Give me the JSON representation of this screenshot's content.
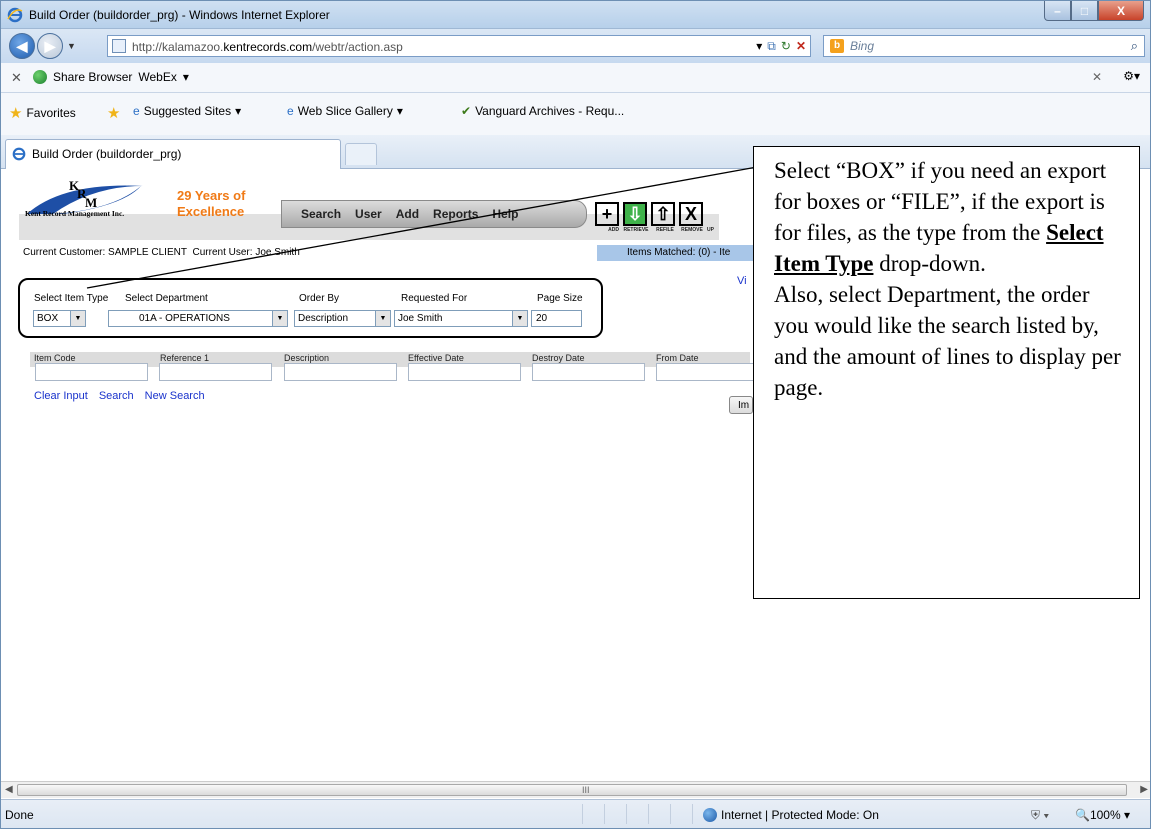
{
  "window": {
    "title": "Build Order (buildorder_prg) - Windows Internet Explorer"
  },
  "address": {
    "url_prefix": "http://kalamazoo.",
    "url_domain": "kentrecords.com",
    "url_suffix": "/webtr/action.asp"
  },
  "search": {
    "placeholder": "Bing"
  },
  "toolbar": {
    "share_browser": "Share Browser",
    "webex": "WebEx"
  },
  "favorites": {
    "label": "Favorites",
    "items": [
      "Suggested Sites",
      "Web Slice Gallery",
      "Vanguard Archives - Requ..."
    ]
  },
  "tab": {
    "title": "Build Order (buildorder_prg)"
  },
  "app": {
    "logo_brand": "Kent Record Management Inc.",
    "logo_letters": "KRM",
    "tagline_1": "29 Years of",
    "tagline_2": "Excellence",
    "menu": [
      "Search",
      "User",
      "Add",
      "Reports",
      "Help"
    ],
    "actions": [
      {
        "symbol": "+",
        "label": "ADD"
      },
      {
        "symbol": "⇩",
        "label": "RETRIEVE"
      },
      {
        "symbol": "⇧",
        "label": "REFILE"
      },
      {
        "symbol": "X",
        "label": "REMOVE"
      }
    ],
    "action_extra_label": "UP",
    "customer_label": "Current Customer:",
    "customer": "SAMPLE CLIENT",
    "user_label": "Current User:",
    "user": "Joe Smith",
    "items_matched": "Items Matched: (0) - Ite",
    "vi_link": "Vi"
  },
  "filters": {
    "item_type_label": "Select Item Type",
    "item_type_value": "BOX",
    "department_label": "Select Department",
    "department_value": "01A - OPERATIONS",
    "order_by_label": "Order By",
    "order_by_value": "Description",
    "requested_for_label": "Requested For",
    "requested_for_value": "Joe Smith",
    "page_size_label": "Page Size",
    "page_size_value": "20"
  },
  "grid": {
    "columns": [
      "Item Code",
      "Reference 1",
      "Description",
      "Effective Date",
      "Destroy Date",
      "From Date"
    ]
  },
  "links": [
    "Clear Input",
    "Search",
    "New Search"
  ],
  "im_button": "Im",
  "callout": {
    "text_1": "Select “BOX” if you need an export for boxes or “FILE”, if the export is for files, as the type from the ",
    "emphasis": "Select Item Type",
    "text_2": " drop-down.",
    "text_3": "Also, select Department, the order you would like the search listed by, and the amount of lines to display per page."
  },
  "status": {
    "left": "Done",
    "zone": "Internet | Protected Mode: On",
    "zoom": "100%"
  }
}
